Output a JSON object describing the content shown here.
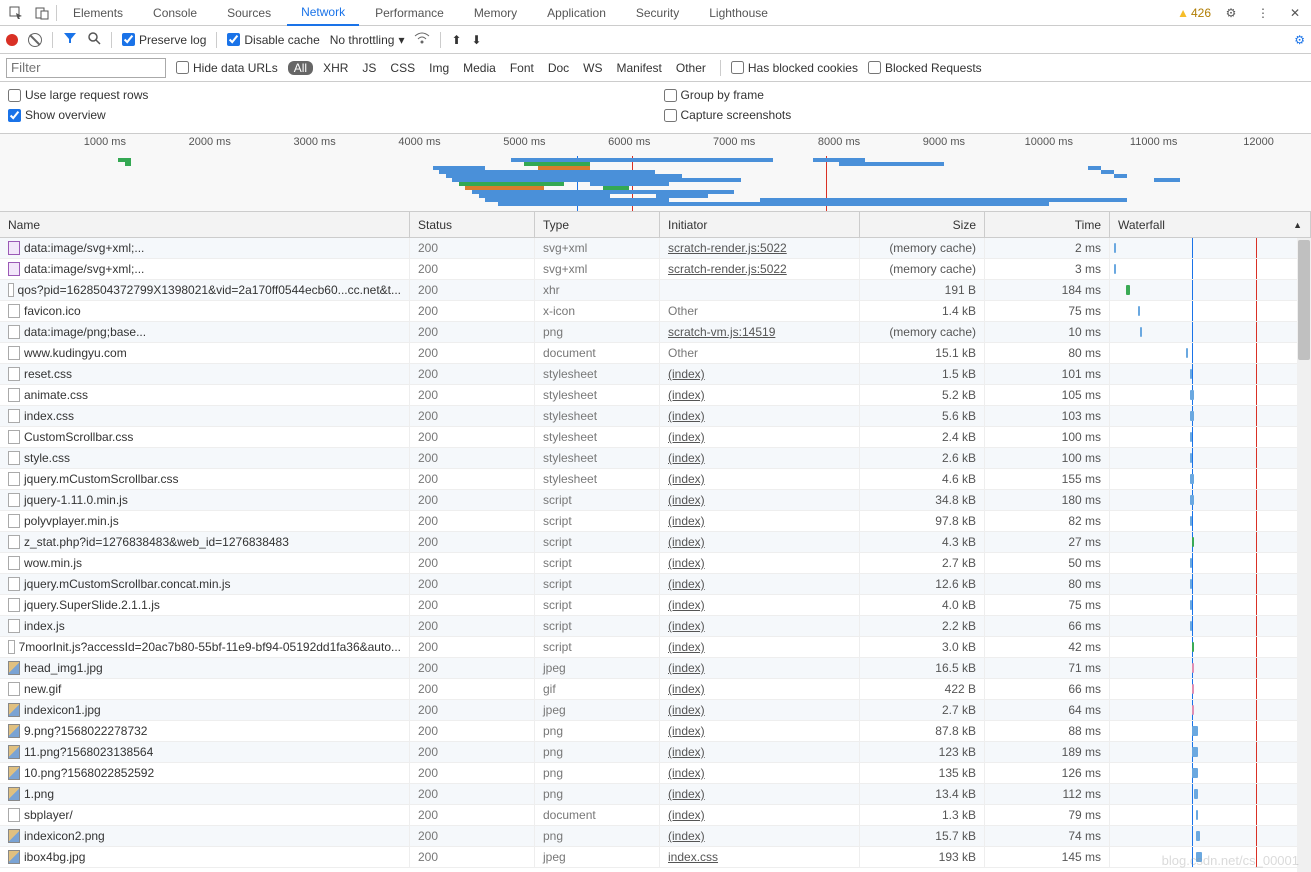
{
  "tabs": [
    "Elements",
    "Console",
    "Sources",
    "Network",
    "Performance",
    "Memory",
    "Application",
    "Security",
    "Lighthouse"
  ],
  "activeTab": "Network",
  "warnCount": "426",
  "toolbar": {
    "preserveLog": "Preserve log",
    "disableCache": "Disable cache",
    "throttling": "No throttling"
  },
  "filterbar": {
    "filterPlaceholder": "Filter",
    "hideDataUrls": "Hide data URLs",
    "types": [
      "All",
      "XHR",
      "JS",
      "CSS",
      "Img",
      "Media",
      "Font",
      "Doc",
      "WS",
      "Manifest",
      "Other"
    ],
    "activeType": "All",
    "hasBlockedCookies": "Has blocked cookies",
    "blockedRequests": "Blocked Requests"
  },
  "opts": {
    "largeRows": "Use large request rows",
    "showOverview": "Show overview",
    "groupByFrame": "Group by frame",
    "captureScreenshots": "Capture screenshots"
  },
  "timelineTicks": [
    "1000 ms",
    "2000 ms",
    "3000 ms",
    "4000 ms",
    "5000 ms",
    "6000 ms",
    "7000 ms",
    "8000 ms",
    "9000 ms",
    "10000 ms",
    "11000 ms",
    "12000"
  ],
  "headers": {
    "name": "Name",
    "status": "Status",
    "type": "Type",
    "initiator": "Initiator",
    "size": "Size",
    "time": "Time",
    "waterfall": "Waterfall"
  },
  "rows": [
    {
      "ico": "purple",
      "name": "data:image/svg+xml;...",
      "status": "200",
      "type": "svg+xml",
      "init": "scratch-render.js:5022",
      "initLink": true,
      "size": "(memory cache)",
      "mem": true,
      "time": "2 ms",
      "wf": {
        "l": 2,
        "w": 1,
        "c": "bl"
      }
    },
    {
      "ico": "purple",
      "name": "data:image/svg+xml;...",
      "status": "200",
      "type": "svg+xml",
      "init": "scratch-render.js:5022",
      "initLink": true,
      "size": "(memory cache)",
      "mem": true,
      "time": "3 ms",
      "wf": {
        "l": 2,
        "w": 1,
        "c": "bl"
      }
    },
    {
      "ico": "",
      "name": "qos?pid=1628504372799X1398021&vid=2a170ff0544ecb60...cc.net&t...",
      "status": "200",
      "type": "xhr",
      "init": "",
      "initLink": false,
      "size": "191 B",
      "time": "184 ms",
      "wf": {
        "l": 8,
        "w": 2,
        "c": "gr"
      }
    },
    {
      "ico": "",
      "name": "favicon.ico",
      "status": "200",
      "type": "x-icon",
      "init": "Other",
      "initLink": false,
      "size": "1.4 kB",
      "time": "75 ms",
      "wf": {
        "l": 14,
        "w": 1,
        "c": "bl"
      }
    },
    {
      "ico": "",
      "name": "data:image/png;base...",
      "status": "200",
      "type": "png",
      "init": "scratch-vm.js:14519",
      "initLink": true,
      "size": "(memory cache)",
      "mem": true,
      "time": "10 ms",
      "wf": {
        "l": 15,
        "w": 1,
        "c": "bl"
      }
    },
    {
      "ico": "",
      "name": "www.kudingyu.com",
      "status": "200",
      "type": "document",
      "init": "Other",
      "initLink": false,
      "size": "15.1 kB",
      "time": "80 ms",
      "wf": {
        "l": 38,
        "w": 1,
        "c": "bl"
      }
    },
    {
      "ico": "",
      "name": "reset.css",
      "status": "200",
      "type": "stylesheet",
      "init": "(index)",
      "initLink": true,
      "size": "1.5 kB",
      "time": "101 ms",
      "wf": {
        "l": 40,
        "w": 1,
        "c": "bl"
      }
    },
    {
      "ico": "",
      "name": "animate.css",
      "status": "200",
      "type": "stylesheet",
      "init": "(index)",
      "initLink": true,
      "size": "5.2 kB",
      "time": "105 ms",
      "wf": {
        "l": 40,
        "w": 2,
        "c": "bl"
      }
    },
    {
      "ico": "",
      "name": "index.css",
      "status": "200",
      "type": "stylesheet",
      "init": "(index)",
      "initLink": true,
      "size": "5.6 kB",
      "time": "103 ms",
      "wf": {
        "l": 40,
        "w": 2,
        "c": "bl"
      }
    },
    {
      "ico": "",
      "name": "CustomScrollbar.css",
      "status": "200",
      "type": "stylesheet",
      "init": "(index)",
      "initLink": true,
      "size": "2.4 kB",
      "time": "100 ms",
      "wf": {
        "l": 40,
        "w": 1,
        "c": "bl"
      }
    },
    {
      "ico": "",
      "name": "style.css",
      "status": "200",
      "type": "stylesheet",
      "init": "(index)",
      "initLink": true,
      "size": "2.6 kB",
      "time": "100 ms",
      "wf": {
        "l": 40,
        "w": 1,
        "c": "bl"
      }
    },
    {
      "ico": "",
      "name": "jquery.mCustomScrollbar.css",
      "status": "200",
      "type": "stylesheet",
      "init": "(index)",
      "initLink": true,
      "size": "4.6 kB",
      "time": "155 ms",
      "wf": {
        "l": 40,
        "w": 2,
        "c": "bl"
      }
    },
    {
      "ico": "",
      "name": "jquery-1.11.0.min.js",
      "status": "200",
      "type": "script",
      "init": "(index)",
      "initLink": true,
      "size": "34.8 kB",
      "time": "180 ms",
      "wf": {
        "l": 40,
        "w": 2,
        "c": "bl"
      }
    },
    {
      "ico": "",
      "name": "polyvplayer.min.js",
      "status": "200",
      "type": "script",
      "init": "(index)",
      "initLink": true,
      "size": "97.8 kB",
      "time": "82 ms",
      "wf": {
        "l": 40,
        "w": 1,
        "c": "bl"
      }
    },
    {
      "ico": "",
      "name": "z_stat.php?id=1276838483&web_id=1276838483",
      "status": "200",
      "type": "script",
      "init": "(index)",
      "initLink": true,
      "size": "4.3 kB",
      "time": "27 ms",
      "wf": {
        "l": 41,
        "w": 1,
        "c": "gr"
      }
    },
    {
      "ico": "",
      "name": "wow.min.js",
      "status": "200",
      "type": "script",
      "init": "(index)",
      "initLink": true,
      "size": "2.7 kB",
      "time": "50 ms",
      "wf": {
        "l": 40,
        "w": 1,
        "c": "bl"
      }
    },
    {
      "ico": "",
      "name": "jquery.mCustomScrollbar.concat.min.js",
      "status": "200",
      "type": "script",
      "init": "(index)",
      "initLink": true,
      "size": "12.6 kB",
      "time": "80 ms",
      "wf": {
        "l": 40,
        "w": 1,
        "c": "bl"
      }
    },
    {
      "ico": "",
      "name": "jquery.SuperSlide.2.1.1.js",
      "status": "200",
      "type": "script",
      "init": "(index)",
      "initLink": true,
      "size": "4.0 kB",
      "time": "75 ms",
      "wf": {
        "l": 40,
        "w": 1,
        "c": "bl"
      }
    },
    {
      "ico": "",
      "name": "index.js",
      "status": "200",
      "type": "script",
      "init": "(index)",
      "initLink": true,
      "size": "2.2 kB",
      "time": "66 ms",
      "wf": {
        "l": 40,
        "w": 1,
        "c": "bl"
      }
    },
    {
      "ico": "",
      "name": "7moorInit.js?accessId=20ac7b80-55bf-11e9-bf94-05192dd1fa36&auto...",
      "status": "200",
      "type": "script",
      "init": "(index)",
      "initLink": true,
      "size": "3.0 kB",
      "time": "42 ms",
      "wf": {
        "l": 41,
        "w": 1,
        "c": "gr"
      }
    },
    {
      "ico": "img",
      "name": "head_img1.jpg",
      "status": "200",
      "type": "jpeg",
      "init": "(index)",
      "initLink": true,
      "size": "16.5 kB",
      "time": "71 ms",
      "wf": {
        "l": 41,
        "w": 1,
        "c": "pk"
      }
    },
    {
      "ico": "",
      "name": "new.gif",
      "status": "200",
      "type": "gif",
      "init": "(index)",
      "initLink": true,
      "size": "422 B",
      "time": "66 ms",
      "wf": {
        "l": 41,
        "w": 1,
        "c": "pk"
      }
    },
    {
      "ico": "img",
      "name": "indexicon1.jpg",
      "status": "200",
      "type": "jpeg",
      "init": "(index)",
      "initLink": true,
      "size": "2.7 kB",
      "time": "64 ms",
      "wf": {
        "l": 41,
        "w": 1,
        "c": "pk"
      }
    },
    {
      "ico": "img",
      "name": "9.png?1568022278732",
      "status": "200",
      "type": "png",
      "init": "(index)",
      "initLink": true,
      "size": "87.8 kB",
      "time": "88 ms",
      "wf": {
        "l": 41,
        "w": 3,
        "c": "bl"
      }
    },
    {
      "ico": "img",
      "name": "11.png?1568023138564",
      "status": "200",
      "type": "png",
      "init": "(index)",
      "initLink": true,
      "size": "123 kB",
      "time": "189 ms",
      "wf": {
        "l": 41,
        "w": 3,
        "c": "bl"
      }
    },
    {
      "ico": "img",
      "name": "10.png?1568022852592",
      "status": "200",
      "type": "png",
      "init": "(index)",
      "initLink": true,
      "size": "135 kB",
      "time": "126 ms",
      "wf": {
        "l": 41,
        "w": 3,
        "c": "bl"
      }
    },
    {
      "ico": "img",
      "name": "1.png",
      "status": "200",
      "type": "png",
      "init": "(index)",
      "initLink": true,
      "size": "13.4 kB",
      "time": "112 ms",
      "wf": {
        "l": 42,
        "w": 2,
        "c": "bl"
      }
    },
    {
      "ico": "",
      "name": "sbplayer/",
      "status": "200",
      "type": "document",
      "init": "(index)",
      "initLink": true,
      "size": "1.3 kB",
      "time": "79 ms",
      "wf": {
        "l": 43,
        "w": 1,
        "c": "bl"
      }
    },
    {
      "ico": "img",
      "name": "indexicon2.png",
      "status": "200",
      "type": "png",
      "init": "(index)",
      "initLink": true,
      "size": "15.7 kB",
      "time": "74 ms",
      "wf": {
        "l": 43,
        "w": 2,
        "c": "bl"
      }
    },
    {
      "ico": "img",
      "name": "ibox4bg.jpg",
      "status": "200",
      "type": "jpeg",
      "init": "index.css",
      "initLink": true,
      "size": "193 kB",
      "time": "145 ms",
      "wf": {
        "l": 43,
        "w": 3,
        "c": "bl"
      }
    }
  ],
  "watermark": "blog.csdn.net/cs_00001"
}
